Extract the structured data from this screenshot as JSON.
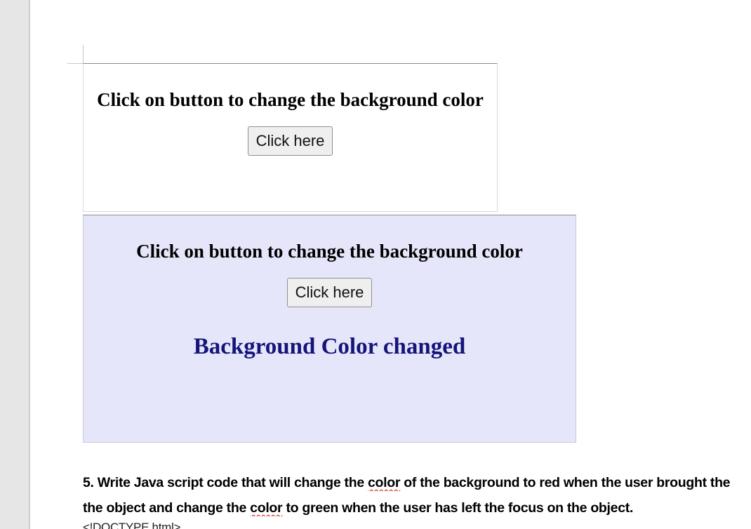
{
  "screenshot_one": {
    "heading": "Click on button to change the background color",
    "button_label": "Click here"
  },
  "screenshot_two": {
    "heading": "Click on button to change the background color",
    "button_label": "Click here",
    "result_text": "Background Color changed",
    "background_color": "#e6e6fa",
    "result_color": "#14147a"
  },
  "document": {
    "question_line1_before": "5. Write Java script code that will change the ",
    "question_line1_word": "color",
    "question_line1_after": " of the background to red when the user brought the",
    "question_line2_before": "the object and change the ",
    "question_line2_word": "color",
    "question_line2_after": " to green when the user has left the focus on the object.",
    "code_line": "<!DOCTYPE html>"
  },
  "spellcheck_underline_color": "#d00000"
}
